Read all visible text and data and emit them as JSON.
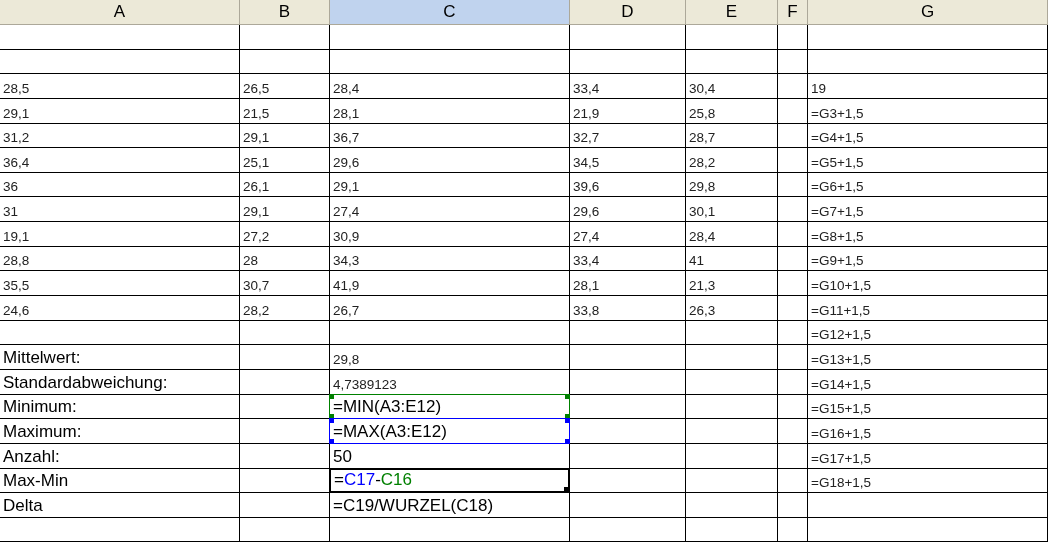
{
  "columns": [
    {
      "label": "A",
      "selected": false
    },
    {
      "label": "B",
      "selected": false
    },
    {
      "label": "C",
      "selected": true
    },
    {
      "label": "D",
      "selected": false
    },
    {
      "label": "E",
      "selected": false
    },
    {
      "label": "F",
      "selected": false
    },
    {
      "label": "G",
      "selected": false
    }
  ],
  "rows": [
    {},
    {},
    {
      "a": {
        "text": "28,5"
      },
      "b": {
        "text": "26,5"
      },
      "c": {
        "text": "28,4"
      },
      "d": {
        "text": "33,4"
      },
      "e": {
        "text": "30,4"
      },
      "g": {
        "text": "19"
      }
    },
    {
      "a": {
        "text": "29,1"
      },
      "b": {
        "text": "21,5"
      },
      "c": {
        "text": "28,1"
      },
      "d": {
        "text": "21,9"
      },
      "e": {
        "text": "25,8"
      },
      "g": {
        "text": "=G3+1,5"
      }
    },
    {
      "a": {
        "text": "31,2"
      },
      "b": {
        "text": "29,1"
      },
      "c": {
        "text": "36,7"
      },
      "d": {
        "text": "32,7"
      },
      "e": {
        "text": "28,7"
      },
      "g": {
        "text": "=G4+1,5"
      }
    },
    {
      "a": {
        "text": "36,4"
      },
      "b": {
        "text": "25,1"
      },
      "c": {
        "text": "29,6"
      },
      "d": {
        "text": "34,5"
      },
      "e": {
        "text": "28,2"
      },
      "g": {
        "text": "=G5+1,5"
      }
    },
    {
      "a": {
        "text": "36"
      },
      "b": {
        "text": "26,1"
      },
      "c": {
        "text": "29,1"
      },
      "d": {
        "text": "39,6"
      },
      "e": {
        "text": "29,8"
      },
      "g": {
        "text": "=G6+1,5"
      }
    },
    {
      "a": {
        "text": "31"
      },
      "b": {
        "text": "29,1"
      },
      "c": {
        "text": "27,4"
      },
      "d": {
        "text": "29,6"
      },
      "e": {
        "text": "30,1"
      },
      "g": {
        "text": "=G7+1,5"
      }
    },
    {
      "a": {
        "text": "19,1"
      },
      "b": {
        "text": "27,2"
      },
      "c": {
        "text": "30,9"
      },
      "d": {
        "text": "27,4"
      },
      "e": {
        "text": "28,4"
      },
      "g": {
        "text": "=G8+1,5"
      }
    },
    {
      "a": {
        "text": "28,8"
      },
      "b": {
        "text": "28"
      },
      "c": {
        "text": "34,3"
      },
      "d": {
        "text": "33,4"
      },
      "e": {
        "text": "41"
      },
      "g": {
        "text": "=G9+1,5"
      }
    },
    {
      "a": {
        "text": "35,5"
      },
      "b": {
        "text": "30,7"
      },
      "c": {
        "text": "41,9"
      },
      "d": {
        "text": "28,1"
      },
      "e": {
        "text": "21,3"
      },
      "g": {
        "text": "=G10+1,5"
      }
    },
    {
      "a": {
        "text": "24,6"
      },
      "b": {
        "text": "28,2"
      },
      "c": {
        "text": "26,7"
      },
      "d": {
        "text": "33,8"
      },
      "e": {
        "text": "26,3"
      },
      "g": {
        "text": "=G11+1,5"
      }
    },
    {
      "g": {
        "text": "=G12+1,5"
      }
    },
    {
      "a": {
        "text": "Mittelwert:",
        "kind": "large"
      },
      "c": {
        "text": "29,8"
      },
      "g": {
        "text": "=G13+1,5"
      }
    },
    {
      "a": {
        "text": "Standardabweichung:",
        "kind": "large"
      },
      "c": {
        "text": "4,7389123"
      },
      "g": {
        "text": "=G14+1,5"
      }
    },
    {
      "a": {
        "text": "Minimum:",
        "kind": "large"
      },
      "c": {
        "text": "=MIN(A3:E12)",
        "kind": "large",
        "color": "#008000"
      },
      "g": {
        "text": "=G15+1,5"
      }
    },
    {
      "a": {
        "text": "Maximum:",
        "kind": "large"
      },
      "c": {
        "text": "=MAX(A3:E12)",
        "kind": "large",
        "color": "#0000ff"
      },
      "g": {
        "text": "=G16+1,5"
      }
    },
    {
      "a": {
        "text": "Anzahl:",
        "kind": "large"
      },
      "c": {
        "text": "50",
        "kind": "large"
      },
      "g": {
        "text": "=G17+1,5"
      }
    },
    {
      "a": {
        "text": "Max-Min",
        "kind": "large"
      },
      "c": {
        "kind": "large",
        "active": true,
        "parts": [
          {
            "text": "=",
            "color": "#000000"
          },
          {
            "text": "C17",
            "color": "#0000ff"
          },
          {
            "text": "-",
            "color": "#000000"
          },
          {
            "text": "C16",
            "color": "#008000"
          }
        ]
      },
      "g": {
        "text": "=G18+1,5"
      }
    },
    {
      "a": {
        "text": "Delta",
        "kind": "large"
      },
      "c": {
        "text": "=C19/WURZEL(C18)",
        "kind": "large"
      }
    },
    {}
  ]
}
